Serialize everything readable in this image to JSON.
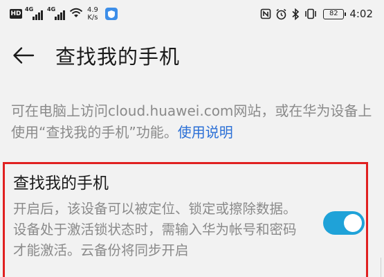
{
  "status_bar": {
    "hd_badge": "HD",
    "sim1_gen": "4G",
    "sim2_gen": "4G",
    "speed_value": "4.9",
    "speed_unit": "K/s",
    "battery": "82",
    "time": "4:02",
    "icons": [
      "nfc-icon",
      "alarm-icon",
      "bluetooth-icon",
      "vibrate-icon"
    ]
  },
  "app_bar": {
    "title": "查找我的手机",
    "back_icon": "arrow-left-icon"
  },
  "description": {
    "text": "可在电脑上访问cloud.huawei.com网站，或在华为设备上使用“查找我的手机”功能。",
    "link": "使用说明"
  },
  "setting": {
    "title": "查找我的手机",
    "description": "开启后，该设备可以被定位、锁定或擦除数据。设备处于激活锁状态时，需输入华为帐号和密码才能激活。云备份将同步开启",
    "enabled": true
  },
  "colors": {
    "accent": "#1fa2d8",
    "link": "#2a6fd6",
    "highlight_border": "#e02020"
  }
}
